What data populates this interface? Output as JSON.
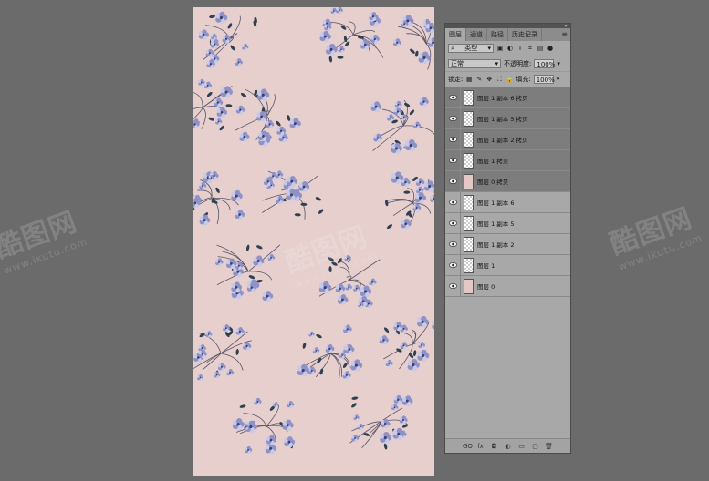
{
  "watermark": {
    "brand": "酷图网",
    "url": "www.ikutu.com"
  },
  "panel": {
    "tabs": [
      "图层",
      "通道",
      "路径",
      "历史记录"
    ],
    "menu_icon": "menu-icon",
    "filter": {
      "value": "类型"
    },
    "blend": {
      "value": "正常"
    },
    "opacity": {
      "label": "不透明度:",
      "value": "100%"
    },
    "lock": {
      "label": "锁定:"
    },
    "fill": {
      "label": "填充:",
      "value": "100%"
    },
    "layers": [
      {
        "name": "图层 1 副本 6 拷贝"
      },
      {
        "name": "图层 1 副本 5 拷贝"
      },
      {
        "name": "图层 1 副本 2 拷贝"
      },
      {
        "name": "图层 1 拷贝"
      },
      {
        "name": "图层 0 拷贝"
      },
      {
        "name": "图层 1 副本 6"
      },
      {
        "name": "图层 1 副本 5"
      },
      {
        "name": "图层 1 副本 2"
      },
      {
        "name": "图层 1"
      },
      {
        "name": "图层 0"
      }
    ],
    "bottom_icons": [
      "GO",
      "fx",
      "◘",
      "◐",
      "▭",
      "▢",
      "🗑"
    ]
  },
  "colors": {
    "workspace": "#6b6b6b",
    "canvas": "#e6cfcd",
    "panel": "#a8a8a8",
    "selected_layer": "#7d7d7d",
    "flower": "#8f92c8",
    "leaf": "#2f4050"
  }
}
